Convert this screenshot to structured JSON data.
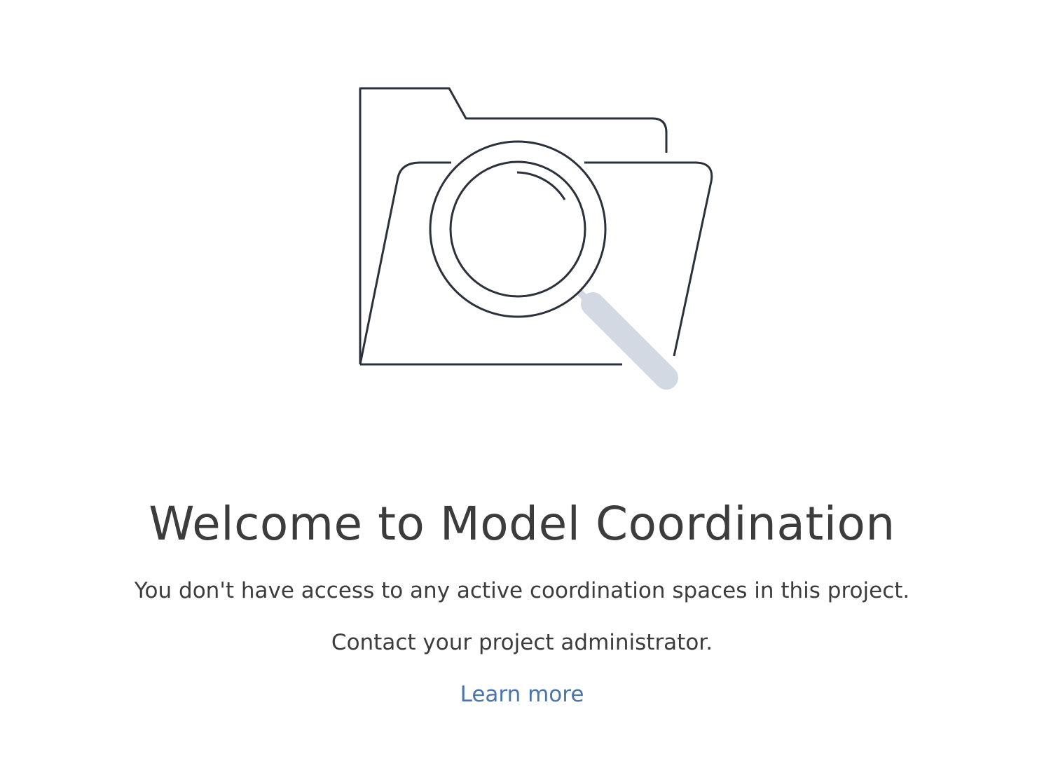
{
  "empty_state": {
    "title": "Welcome to Model Coordination",
    "message": "You don't have access to any active coordination spaces in this project.",
    "contact": "Contact your project administrator.",
    "learn_more_label": "Learn more",
    "illustration_icon": "folder-search-icon"
  },
  "colors": {
    "text": "#3c3c3c",
    "link": "#4a74ad",
    "illustration_stroke": "#2b313b",
    "magnifier_handle": "#d2d9e2"
  }
}
